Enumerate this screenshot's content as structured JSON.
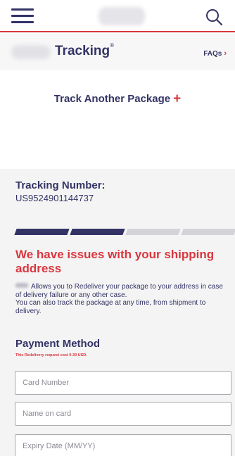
{
  "header": {
    "menu_icon": "hamburger-menu-icon",
    "search_icon": "search-icon",
    "accent_color": "#d9363e",
    "brand_color": "#333366"
  },
  "subheader": {
    "title": "Tracking",
    "title_mark": "®",
    "faqs_label": "FAQs",
    "faqs_chevron": "›"
  },
  "track_another": {
    "label": "Track Another Package",
    "plus": "+"
  },
  "tracking": {
    "number_label": "Tracking Number:",
    "number_value": "US9524901144737"
  },
  "progress": {
    "steps_total": 4,
    "steps_completed": 2,
    "completed_color": "#333366",
    "pending_color": "#d4d4d8"
  },
  "issue": {
    "title": "We have issues with your shipping address",
    "description_line1": "Allows you to Redeliver your package to your address in case of delivery failure or any other case.",
    "description_line2": "You can also track the package at any time, from shipment to delivery."
  },
  "payment": {
    "title": "Payment Method",
    "note": "This Redelivery request cost 0.30 USD.",
    "card_number_placeholder": "Card Number",
    "name_on_card_placeholder": "Name on card",
    "expiry_placeholder": "Expiry Date (MM/YY)"
  }
}
